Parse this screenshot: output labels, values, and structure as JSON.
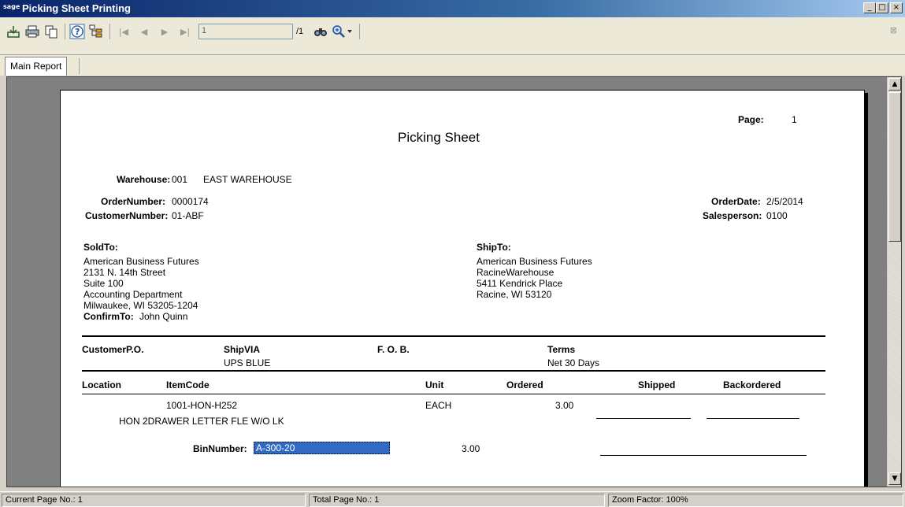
{
  "window": {
    "logo": "sage",
    "title": "Picking Sheet Printing"
  },
  "toolbar": {
    "page_value": "1",
    "page_total": "/1"
  },
  "tabs": {
    "main": "Main Report"
  },
  "report": {
    "page_label": "Page:",
    "page_number": "1",
    "title": "Picking Sheet",
    "warehouse_label": "Warehouse:",
    "warehouse_code": "001",
    "warehouse_name": "EAST WAREHOUSE",
    "order_number_label": "OrderNumber:",
    "order_number": "0000174",
    "customer_number_label": "CustomerNumber:",
    "customer_number": "01-ABF",
    "order_date_label": "OrderDate:",
    "order_date": "2/5/2014",
    "salesperson_label": "Salesperson:",
    "salesperson": "0100",
    "sold_to_label": "SoldTo:",
    "sold_to": [
      "American Business Futures",
      "2131 N. 14th Street",
      "Suite 100",
      "Accounting Department",
      "Milwaukee, WI  53205-1204"
    ],
    "confirm_to_label": "ConfirmTo:",
    "confirm_to": "John Quinn",
    "ship_to_label": "ShipTo:",
    "ship_to": [
      "American Business Futures",
      "RacineWarehouse",
      "5411 Kendrick Place",
      "Racine, WI  53120"
    ],
    "customer_po_label": "CustomerP.O.",
    "ship_via_label": "ShipVIA",
    "ship_via": "UPS BLUE",
    "fob_label": "F. O. B.",
    "terms_label": "Terms",
    "terms": "Net 30 Days",
    "columns": {
      "location": "Location",
      "item_code": "ItemCode",
      "unit": "Unit",
      "ordered": "Ordered",
      "shipped": "Shipped",
      "backordered": "Backordered"
    },
    "line": {
      "item_code": "1001-HON-H252",
      "unit": "EACH",
      "ordered": "3.00",
      "description": "HON 2DRAWER LETTER FLE W/O LK",
      "bin_label": "BinNumber:",
      "bin_number": "A-300-20",
      "bin_qty": "3.00"
    }
  },
  "status": {
    "current_page": "Current Page No.: 1",
    "total_page": "Total Page No.: 1",
    "zoom": "Zoom Factor: 100%"
  }
}
